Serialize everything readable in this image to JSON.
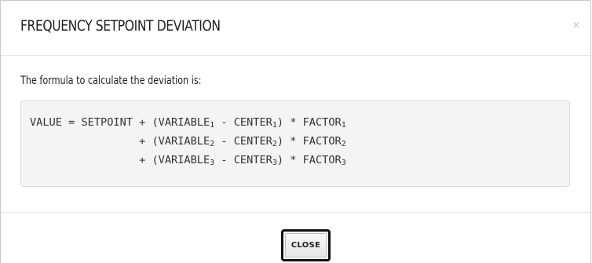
{
  "dialog": {
    "title": "FREQUENCY SETPOINT DEVIATION",
    "close_icon_glyph": "×",
    "close_icon_name": "close-icon"
  },
  "body": {
    "intro": "The formula to calculate the deviation is:",
    "formula": [
      {
        "prefix": "VALUE = SETPOINT + (VARIABLE",
        "sub1": "1",
        "mid": " - CENTER",
        "sub2": "1",
        "mid2": ") * FACTOR",
        "sub3": "1"
      },
      {
        "prefix": "                 + (VARIABLE",
        "sub1": "2",
        "mid": " - CENTER",
        "sub2": "2",
        "mid2": ") * FACTOR",
        "sub3": "2"
      },
      {
        "prefix": "                 + (VARIABLE",
        "sub1": "3",
        "mid": " - CENTER",
        "sub2": "3",
        "mid2": ") * FACTOR",
        "sub3": "3"
      }
    ]
  },
  "footer": {
    "close_label": "CLOSE"
  }
}
